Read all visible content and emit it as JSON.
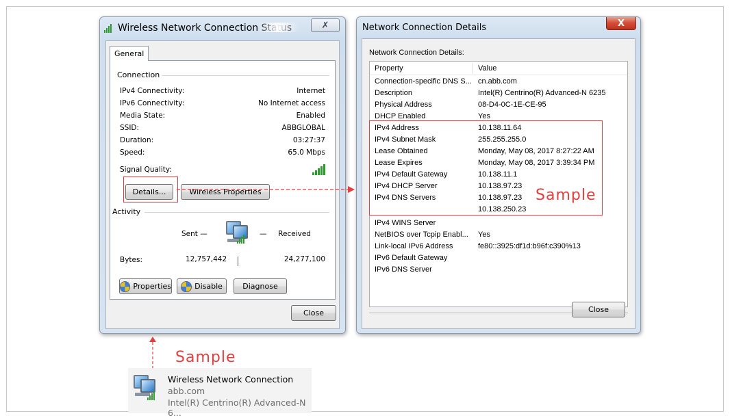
{
  "status_window": {
    "title": "Wireless Network Connection Status",
    "close_glyph": "✗",
    "tab_general": "General",
    "connection_label": "Connection",
    "rows": [
      {
        "label": "IPv4 Connectivity:",
        "value": "Internet"
      },
      {
        "label": "IPv6 Connectivity:",
        "value": "No Internet access"
      },
      {
        "label": "Media State:",
        "value": "Enabled"
      },
      {
        "label": "SSID:",
        "value": "ABBGLOBAL"
      },
      {
        "label": "Duration:",
        "value": "03:27:37"
      },
      {
        "label": "Speed:",
        "value": "65.0 Mbps"
      }
    ],
    "signal_quality_label": "Signal Quality:",
    "details_button": "Details...",
    "wireless_properties_button": "Wireless Properties",
    "activity_label": "Activity",
    "sent_label": "Sent",
    "received_label": "Received",
    "bytes_label": "Bytes:",
    "bytes_sent": "12,757,442",
    "bytes_received": "24,277,100",
    "properties_button": "Properties",
    "disable_button": "Disable",
    "diagnose_button": "Diagnose",
    "close_button": "Close"
  },
  "details_window": {
    "title": "Network Connection Details",
    "close_glyph": "X",
    "list_label": "Network Connection Details:",
    "col_property": "Property",
    "col_value": "Value",
    "rows": [
      {
        "property": "Connection-specific DNS S...",
        "value": "cn.abb.com"
      },
      {
        "property": "Description",
        "value": "Intel(R) Centrino(R) Advanced-N 6235"
      },
      {
        "property": "Physical Address",
        "value": "08-D4-0C-1E-CE-95"
      },
      {
        "property": "DHCP Enabled",
        "value": "Yes"
      },
      {
        "property": "IPv4 Address",
        "value": "10.138.11.64"
      },
      {
        "property": "IPv4 Subnet Mask",
        "value": "255.255.255.0"
      },
      {
        "property": "Lease Obtained",
        "value": "Monday, May 08, 2017 8:27:22 AM"
      },
      {
        "property": "Lease Expires",
        "value": "Monday, May 08, 2017 3:39:34 PM"
      },
      {
        "property": "IPv4 Default Gateway",
        "value": "10.138.11.1"
      },
      {
        "property": "IPv4 DHCP Server",
        "value": "10.138.97.23"
      },
      {
        "property": "IPv4 DNS Servers",
        "value": "10.138.97.23"
      },
      {
        "property": "",
        "value": "10.138.250.23"
      },
      {
        "property": "IPv4 WINS Server",
        "value": ""
      },
      {
        "property": "NetBIOS over Tcpip Enabl...",
        "value": "Yes"
      },
      {
        "property": "Link-local IPv6 Address",
        "value": "fe80::3925:df1d:b96f:c390%13"
      },
      {
        "property": "IPv6 Default Gateway",
        "value": ""
      },
      {
        "property": "IPv6 DNS Server",
        "value": ""
      }
    ],
    "close_button": "Close"
  },
  "annotations": {
    "sample_right": "Sample",
    "sample_bottom": "Sample",
    "accent_color": "#e04040"
  },
  "network_item": {
    "name": "Wireless Network Connection",
    "domain": "abb.com",
    "adapter": "Intel(R) Centrino(R) Advanced-N 6..."
  }
}
